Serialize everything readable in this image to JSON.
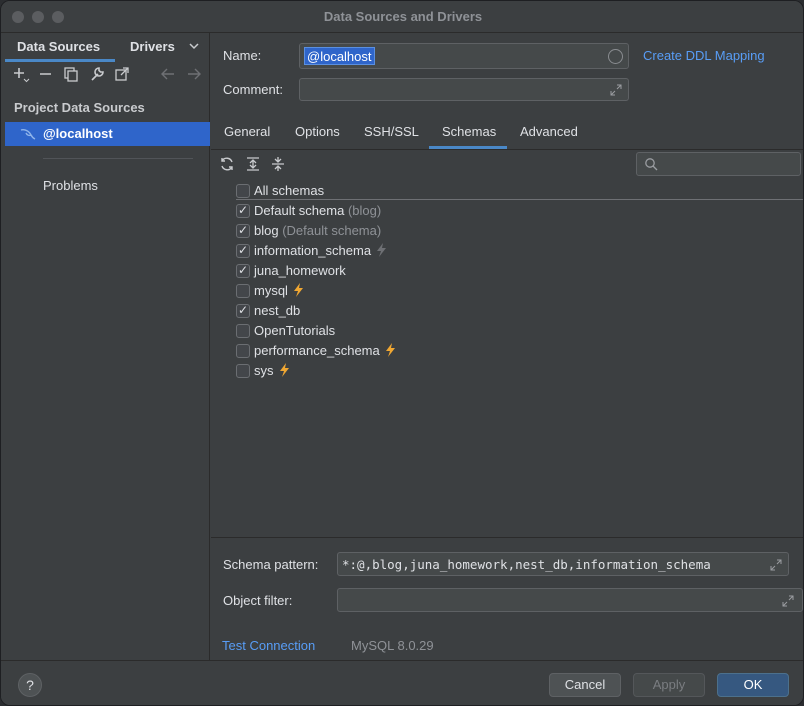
{
  "window": {
    "title": "Data Sources and Drivers"
  },
  "left": {
    "tabs": [
      "Data Sources",
      "Drivers"
    ],
    "section_title": "Project Data Sources",
    "datasource": "@localhost",
    "problems": "Problems"
  },
  "form": {
    "name_label": "Name:",
    "name_value": "@localhost",
    "ddl_link": "Create DDL Mapping",
    "comment_label": "Comment:",
    "comment_value": ""
  },
  "tabs": [
    "General",
    "Options",
    "SSH/SSL",
    "Schemas",
    "Advanced"
  ],
  "active_tab": "Schemas",
  "schemas": [
    {
      "label": "All schemas",
      "sub": "",
      "checked": false,
      "bolt": "none"
    },
    {
      "label": "Default schema",
      "sub": "(blog)",
      "checked": true,
      "bolt": "none"
    },
    {
      "label": "blog",
      "sub": "(Default schema)",
      "checked": true,
      "bolt": "none"
    },
    {
      "label": "information_schema",
      "sub": "",
      "checked": true,
      "bolt": "grey"
    },
    {
      "label": "juna_homework",
      "sub": "",
      "checked": true,
      "bolt": "none"
    },
    {
      "label": "mysql",
      "sub": "",
      "checked": false,
      "bolt": "orange"
    },
    {
      "label": "nest_db",
      "sub": "",
      "checked": true,
      "bolt": "none"
    },
    {
      "label": "OpenTutorials",
      "sub": "",
      "checked": false,
      "bolt": "none"
    },
    {
      "label": "performance_schema",
      "sub": "",
      "checked": false,
      "bolt": "orange"
    },
    {
      "label": "sys",
      "sub": "",
      "checked": false,
      "bolt": "orange"
    }
  ],
  "bottom": {
    "pattern_label": "Schema pattern:",
    "pattern_value": "*:@,blog,juna_homework,nest_db,information_schema",
    "filter_label": "Object filter:",
    "filter_value": "",
    "test_connection": "Test Connection",
    "version": "MySQL 8.0.29"
  },
  "footer": {
    "help": "?",
    "cancel": "Cancel",
    "apply": "Apply",
    "ok": "OK"
  },
  "colors": {
    "accent": "#2f65ca",
    "link": "#589df6",
    "bolt_orange": "#f0a732",
    "bolt_grey": "#6e7074"
  }
}
